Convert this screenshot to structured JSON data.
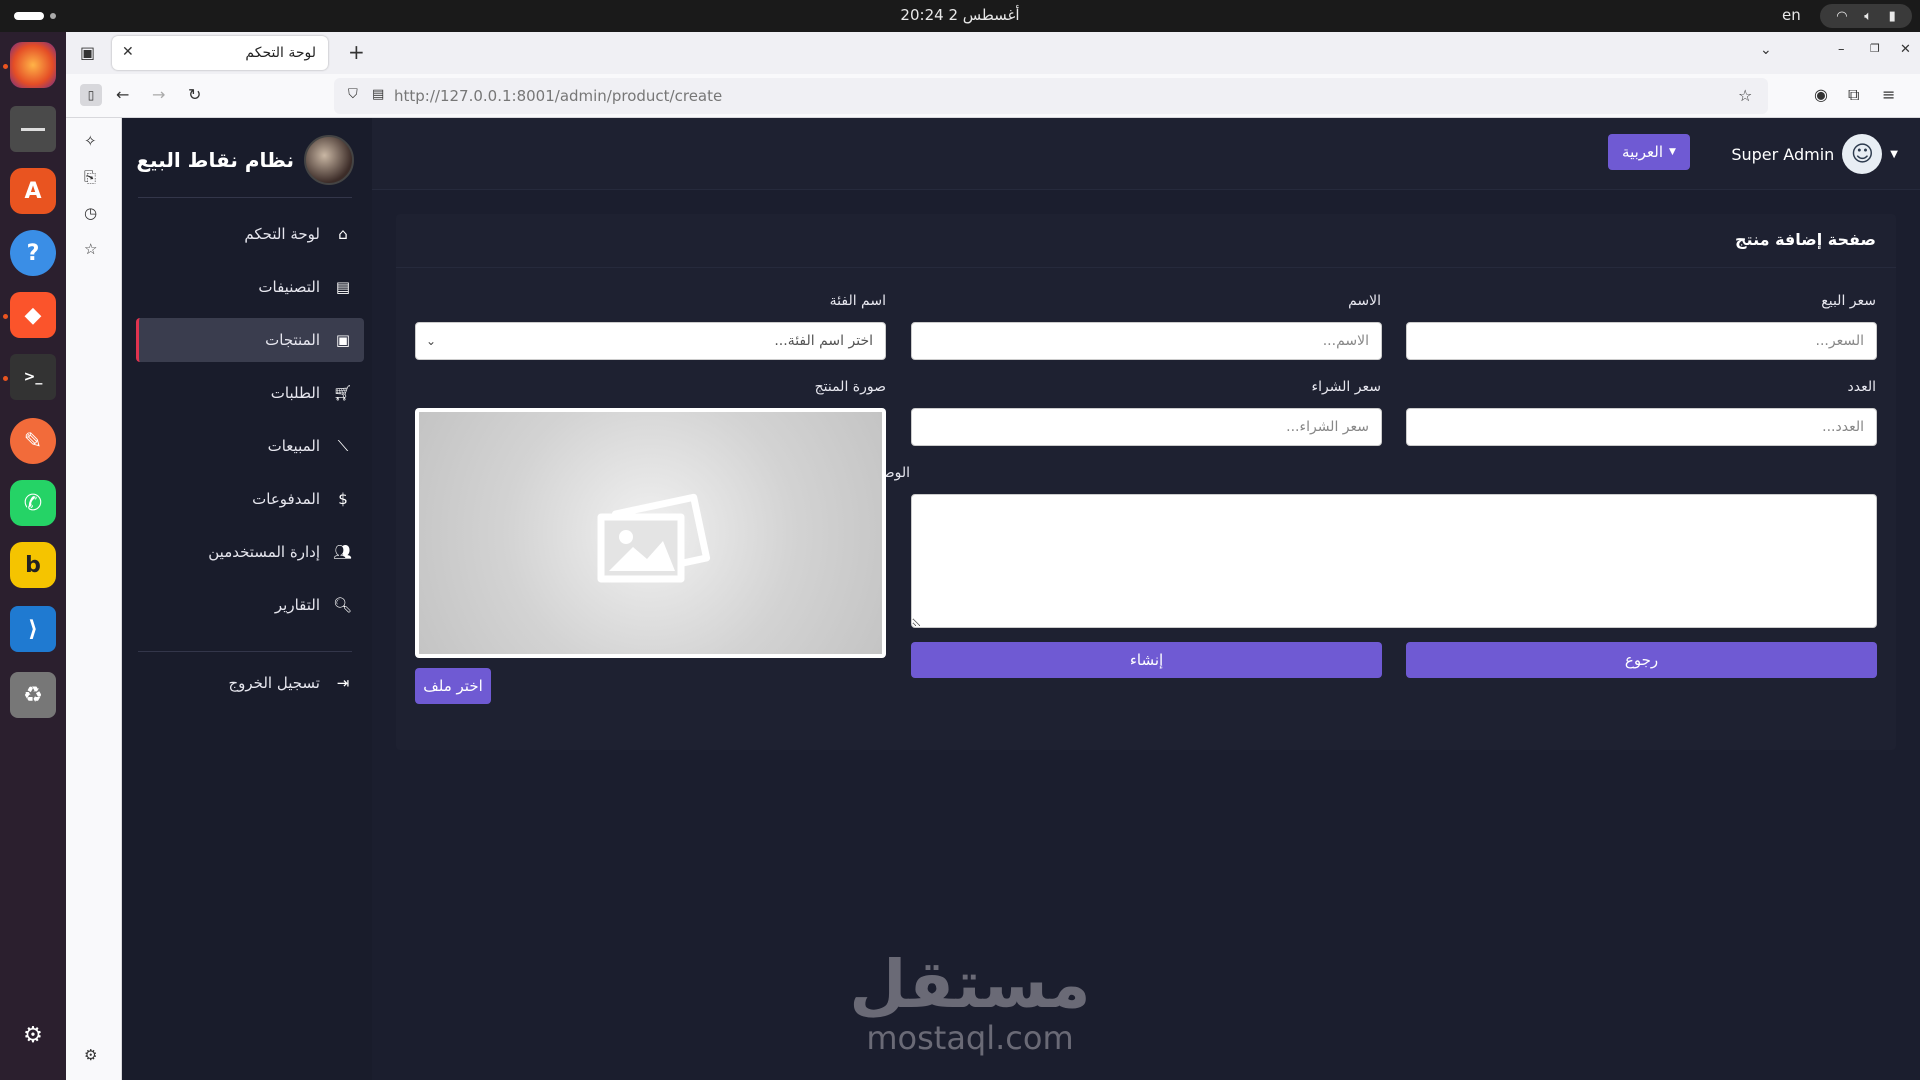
{
  "system": {
    "clock": "أغسطس 2  20:24",
    "keyboard_lang": "en"
  },
  "browser": {
    "tab_title": "لوحة التحكم",
    "url_host": "http://127.0.0.1",
    "url_path": ":8001/admin/product/create"
  },
  "sidebar": {
    "brand_title": "نظام نقاط البيع",
    "items": [
      {
        "label": "لوحة التحكم",
        "icon": "home-icon",
        "active": false
      },
      {
        "label": "التصنيفات",
        "icon": "table-icon",
        "active": false
      },
      {
        "label": "المنتجات",
        "icon": "box-icon",
        "active": true
      },
      {
        "label": "الطلبات",
        "icon": "cart-icon",
        "active": false
      },
      {
        "label": "المبيعات",
        "icon": "chart-line-icon",
        "active": false
      },
      {
        "label": "المدفوعات",
        "icon": "dollar-icon",
        "active": false
      },
      {
        "label": "إدارة المستخدمين",
        "icon": "users-icon",
        "active": false
      },
      {
        "label": "التقارير",
        "icon": "search-chart-icon",
        "active": false
      }
    ],
    "logout_label": "تسجيل الخروج"
  },
  "topnav": {
    "user_name": "Super Admin",
    "language_button": "العربية"
  },
  "form": {
    "title": "صفحة إضافة منتج",
    "sale_price_label": "سعر البيع",
    "sale_price_placeholder": "السعر...",
    "name_label": "الاسم",
    "name_placeholder": "الاسم...",
    "category_label": "اسم الفئة",
    "category_placeholder": "اختر اسم الفئة...",
    "quantity_label": "العدد",
    "quantity_placeholder": "العدد...",
    "purchase_price_label": "سعر الشراء",
    "purchase_price_placeholder": "سعر الشراء...",
    "image_label": "صورة المنتج",
    "description_label": "الوصف",
    "back_button": "رجوع",
    "create_button": "إنشاء",
    "choose_file_button": "اختر ملف"
  },
  "watermark": {
    "arabic": "مستقل",
    "latin": "mostaql.com"
  },
  "colors": {
    "accent": "#6f5ad3",
    "active_marker": "#e0334f",
    "sidebar_bg": "#191c2b",
    "content_bg": "#1b1e2e"
  }
}
